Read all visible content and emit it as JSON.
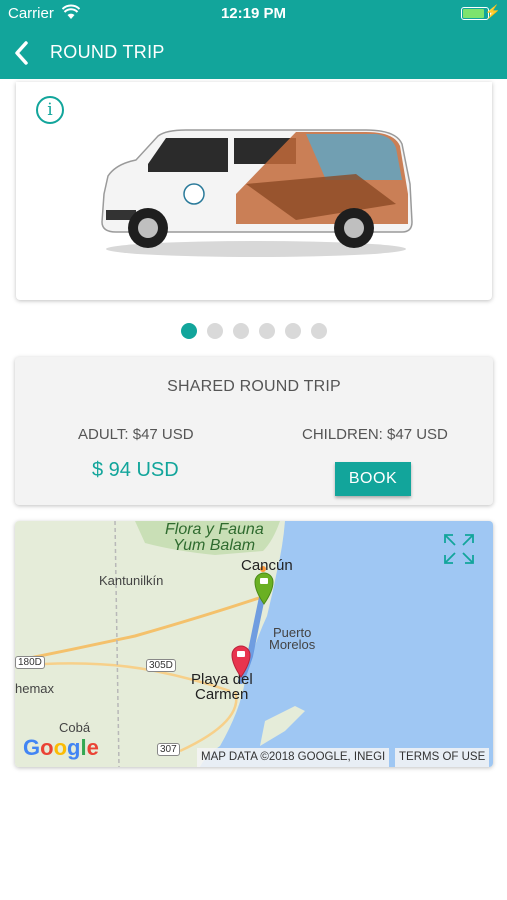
{
  "status_bar": {
    "carrier": "Carrier",
    "time": "12:19 PM",
    "battery_level": 0.9
  },
  "nav": {
    "title": "ROUND TRIP"
  },
  "carousel": {
    "page_count": 6,
    "active_index": 0
  },
  "trip": {
    "title": "SHARED ROUND TRIP",
    "adult_price": "ADULT: $47 USD",
    "children_price": "CHILDREN: $47 USD",
    "total": "$ 94 USD",
    "book_label": "BOOK"
  },
  "map": {
    "labels": {
      "flora_1": "Flora y Fauna",
      "flora_2": "Yum Balam",
      "cancun": "Cancún",
      "kantunilkin": "Kantunilkín",
      "puerto_1": "Puerto",
      "puerto_2": "Morelos",
      "playa_1": "Playa del",
      "playa_2": "Carmen",
      "chemax": "hemax",
      "coba": "Cobá",
      "road_180d": "180D",
      "road_305d": "305D",
      "road_307": "307"
    },
    "google": "Google",
    "attribution": "MAP DATA ©2018 GOOGLE, INEGI",
    "terms": "TERMS OF USE"
  },
  "colors": {
    "accent": "#12a59b",
    "origin_pin": "#6ab023",
    "destination_pin": "#e8344e"
  }
}
